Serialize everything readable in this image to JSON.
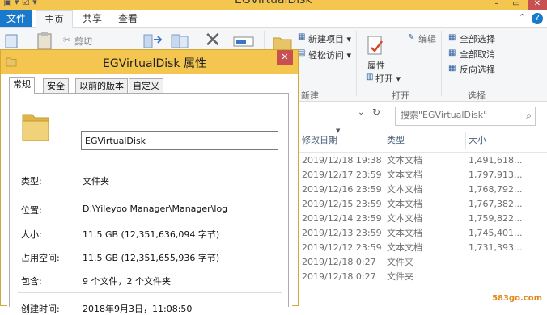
{
  "explorer": {
    "title": "EGVirtualDisk",
    "tabs": [
      "文件",
      "主页",
      "共享",
      "查看"
    ],
    "ribbon": {
      "cut": "剪切",
      "new_item": "新建项目 ▾",
      "easy_access": "轻松访问 ▾",
      "new_group": "新建",
      "properties": "属性",
      "edit": "编辑",
      "open": "打开 ▾",
      "open_group": "打开",
      "select_all": "全部选择",
      "select_none": "全部取消",
      "invert_selection": "反向选择",
      "select_group": "选择"
    },
    "search": {
      "placeholder": "搜索\"EGVirtualDisk\""
    },
    "columns": [
      "修改日期",
      "类型",
      "大小"
    ],
    "rows": [
      {
        "date": "2019/12/18 19:38",
        "type": "文本文档",
        "size": "1,491,618..."
      },
      {
        "date": "2019/12/17 23:59",
        "type": "文本文档",
        "size": "1,797,913..."
      },
      {
        "date": "2019/12/16 23:59",
        "type": "文本文档",
        "size": "1,768,792..."
      },
      {
        "date": "2019/12/15 23:59",
        "type": "文本文档",
        "size": "1,767,382..."
      },
      {
        "date": "2019/12/14 23:59",
        "type": "文本文档",
        "size": "1,759,822..."
      },
      {
        "date": "2019/12/13 23:59",
        "type": "文本文档",
        "size": "1,745,401..."
      },
      {
        "date": "2019/12/12 23:59",
        "type": "文本文档",
        "size": "1,731,393..."
      },
      {
        "date": "2019/12/18 0:27",
        "type": "文件夹",
        "size": ""
      },
      {
        "date": "2019/12/18 0:27",
        "type": "文件夹",
        "size": ""
      }
    ]
  },
  "dialog": {
    "title": "EGVirtualDisk 属性",
    "close": "✕",
    "tabs": [
      "常规",
      "安全",
      "以前的版本",
      "自定义"
    ],
    "name_value": "EGVirtualDisk",
    "props": {
      "type_label": "类型:",
      "type_value": "文件夹",
      "location_label": "位置:",
      "location_value": "D:\\Yileyoo Manager\\Manager\\log",
      "size_label": "大小:",
      "size_value": "11.5 GB (12,351,636,094 字节)",
      "disk_label": "占用空间:",
      "disk_value": "11.5 GB (12,351,655,936 字节)",
      "contains_label": "包含:",
      "contains_value": "9 个文件，2 个文件夹",
      "created_label": "创建时间:",
      "created_value": "2018年9月3日，11:08:50"
    }
  },
  "watermark": "583go.com",
  "colors": {
    "accent": "#1979ca",
    "title_bar": "#f4c64f",
    "close": "#c75050",
    "folder": "#e8c468"
  }
}
